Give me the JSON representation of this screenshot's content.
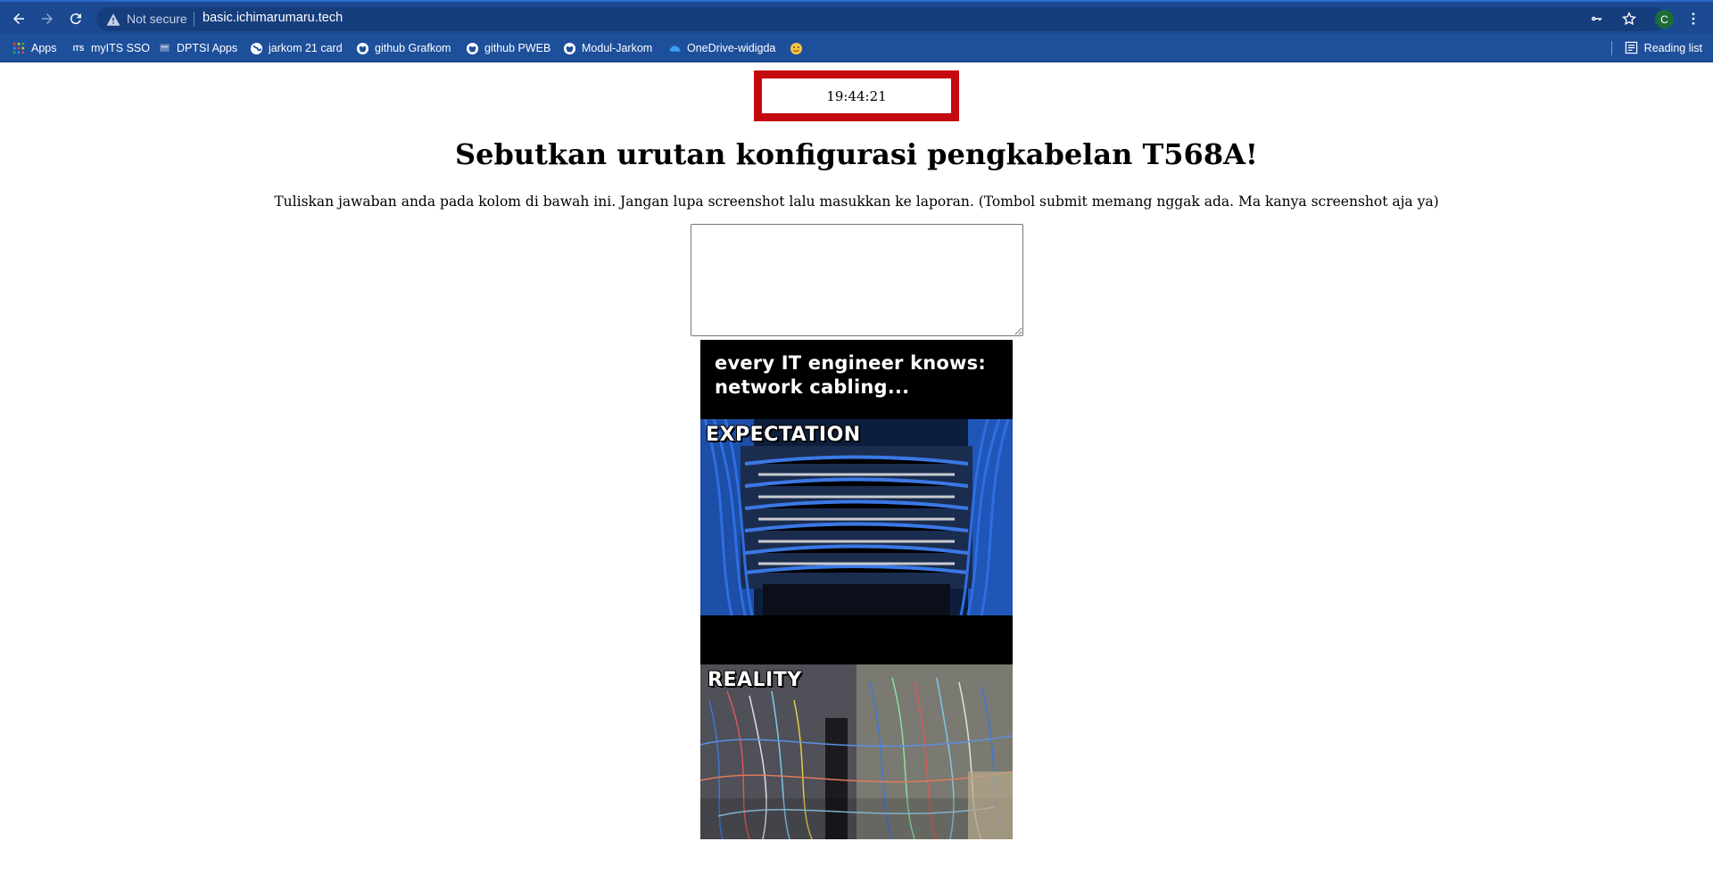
{
  "browser": {
    "security_label": "Not secure",
    "url": "basic.ichimarumaru.tech",
    "avatar_letter": "C",
    "bookmarks": [
      {
        "label": "Apps",
        "icon": "apps-grid-icon"
      },
      {
        "label": "myITS SSO",
        "icon": "its-logo-icon"
      },
      {
        "label": "DPTSI Apps",
        "icon": "dptsi-icon"
      },
      {
        "label": "jarkom 21 card",
        "icon": "globe-icon"
      },
      {
        "label": "github Grafkom",
        "icon": "github-icon"
      },
      {
        "label": "github PWEB",
        "icon": "github-icon"
      },
      {
        "label": "Modul-Jarkom",
        "icon": "github-icon"
      },
      {
        "label": "OneDrive-widigda",
        "icon": "onedrive-icon"
      },
      {
        "label": "",
        "icon": "emoji-icon"
      }
    ],
    "reading_list_label": "Reading list",
    "colors": {
      "toolbar": "#1b4a93",
      "bookmarks_bar": "#1d4f9b"
    }
  },
  "page": {
    "timer": "19:44:21",
    "question": "Sebutkan urutan konfigurasi pengkabelan T568A!",
    "instruction": "Tuliskan jawaban anda pada kolom di bawah ini. Jangan lupa screenshot lalu masukkan ke laporan. (Tombol submit memang nggak ada. Ma kanya screenshot aja ya)",
    "answer_value": "",
    "timer_border_color": "#c4090f",
    "meme": {
      "caption_line1": "every IT engineer knows:",
      "caption_line2": "network cabling...",
      "expectation_label": "EXPECTATION",
      "reality_label": "REALITY"
    }
  }
}
